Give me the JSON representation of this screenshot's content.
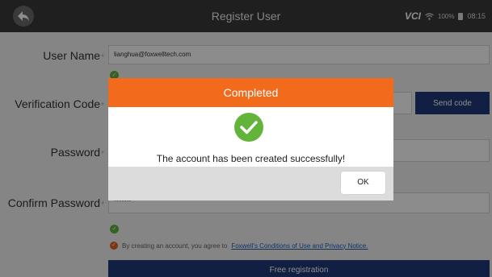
{
  "header": {
    "title": "Register User",
    "vci_label": "VCI",
    "battery_text": "100%",
    "time": "08:15"
  },
  "form": {
    "username_label": "User Name",
    "username_value": "lianghua@foxwelltech.com",
    "verification_label": "Verification Code",
    "send_code_label": "Send code",
    "password_label": "Password",
    "confirm_password_label": "Confirm Password",
    "confirm_password_value": "*******",
    "required_mark": "*",
    "agree_prefix": "By creating an account, you agree to",
    "agree_link": "Foxwell's Conditions of Use and Privacy Notice.",
    "register_button": "Free registration"
  },
  "dialog": {
    "title": "Completed",
    "message": "The account has been created successfully!",
    "ok_label": "OK"
  },
  "colors": {
    "topbar": "#3a3a3a",
    "dialog_header": "#f26a1b",
    "primary_button": "#1e3a78",
    "success": "#63b43a"
  }
}
